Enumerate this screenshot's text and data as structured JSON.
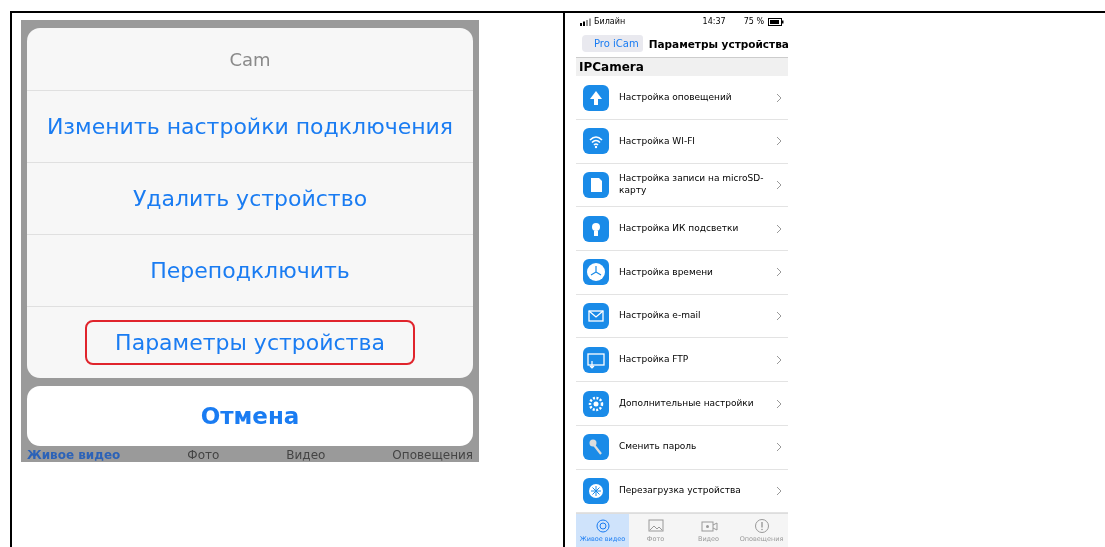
{
  "left_screen": {
    "action_sheet": {
      "title": "Cam",
      "actions": [
        {
          "label": "Изменить настройки подключения",
          "highlighted": false
        },
        {
          "label": "Удалить устройство",
          "highlighted": false
        },
        {
          "label": "Переподключить",
          "highlighted": false
        },
        {
          "label": "Параметры устройства",
          "highlighted": true
        }
      ],
      "cancel": "Отмена"
    },
    "tabs": [
      {
        "label": "Живое видео",
        "selected": true
      },
      {
        "label": "Фото",
        "selected": false
      },
      {
        "label": "Видео",
        "selected": false
      },
      {
        "label": "Оповещения",
        "selected": false
      }
    ]
  },
  "right_screen": {
    "status_bar": {
      "carrier": "Билайн",
      "time": "14:37",
      "battery": "75 %"
    },
    "nav": {
      "back": "Pro iCam",
      "title": "Параметры устройства"
    },
    "section": "IPCamera",
    "items": [
      {
        "label": "Настройка оповещений",
        "kind": "alarm"
      },
      {
        "label": "Настройка WI-FI",
        "kind": "wifi"
      },
      {
        "label": "Настройка записи на microSD-карту",
        "kind": "sd"
      },
      {
        "label": "Настройка ИК подсветки",
        "kind": "ir"
      },
      {
        "label": "Настройка времени",
        "kind": "clock"
      },
      {
        "label": "Настройка e-mail",
        "kind": "mail"
      },
      {
        "label": "Настройка FTP",
        "kind": "ftp"
      },
      {
        "label": "Дополнительные настройки",
        "kind": "gear"
      },
      {
        "label": "Сменить пароль",
        "kind": "key"
      },
      {
        "label": "Перезагрузка устройства",
        "kind": "reboot"
      }
    ],
    "tabs": [
      {
        "label": "Живое видео",
        "kind": "live",
        "selected": true
      },
      {
        "label": "Фото",
        "kind": "photo",
        "selected": false
      },
      {
        "label": "Видео",
        "kind": "video",
        "selected": false
      },
      {
        "label": "Оповещения",
        "kind": "alert",
        "selected": false
      }
    ]
  }
}
